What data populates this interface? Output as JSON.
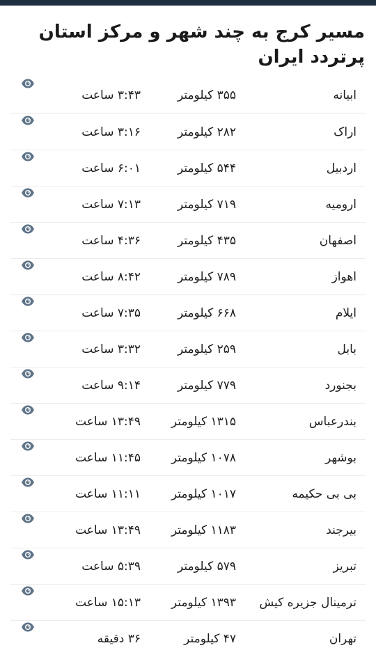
{
  "header": {
    "title": "مسیر کرج به چند شهر و مرکز استان پرتردد ایران"
  },
  "colors": {
    "top_bar": "#1f2d40",
    "eye_icon": "#5f7488",
    "divider": "#ececec"
  },
  "routes": [
    {
      "city": "ابیانه",
      "distance": "۳۵۵ کیلومتر",
      "time": "۳:۴۳ ساعت",
      "icon": "eye-icon"
    },
    {
      "city": "اراک",
      "distance": "۲۸۲ کیلومتر",
      "time": "۳:۱۶ ساعت",
      "icon": "eye-icon"
    },
    {
      "city": "اردبیل",
      "distance": "۵۴۴ کیلومتر",
      "time": "۶:۰۱ ساعت",
      "icon": "eye-icon"
    },
    {
      "city": "ارومیه",
      "distance": "۷۱۹ کیلومتر",
      "time": "۷:۱۳ ساعت",
      "icon": "eye-icon"
    },
    {
      "city": "اصفهان",
      "distance": "۴۳۵ کیلومتر",
      "time": "۴:۳۶ ساعت",
      "icon": "eye-icon"
    },
    {
      "city": "اهواز",
      "distance": "۷۸۹ کیلومتر",
      "time": "۸:۴۲ ساعت",
      "icon": "eye-icon"
    },
    {
      "city": "ایلام",
      "distance": "۶۶۸ کیلومتر",
      "time": "۷:۳۵ ساعت",
      "icon": "eye-icon"
    },
    {
      "city": "بابل",
      "distance": "۲۵۹ کیلومتر",
      "time": "۳:۳۲ ساعت",
      "icon": "eye-icon"
    },
    {
      "city": "بجنورد",
      "distance": "۷۷۹ کیلومتر",
      "time": "۹:۱۴ ساعت",
      "icon": "eye-icon"
    },
    {
      "city": "بندرعباس",
      "distance": "۱۳۱۵ کیلومتر",
      "time": "۱۳:۴۹ ساعت",
      "icon": "eye-icon"
    },
    {
      "city": "بوشهر",
      "distance": "۱۰۷۸ کیلومتر",
      "time": "۱۱:۴۵ ساعت",
      "icon": "eye-icon"
    },
    {
      "city": "بی بی حکیمه",
      "distance": "۱۰۱۷ کیلومتر",
      "time": "۱۱:۱۱ ساعت",
      "icon": "eye-icon"
    },
    {
      "city": "بیرجند",
      "distance": "۱۱۸۳ کیلومتر",
      "time": "۱۳:۴۹ ساعت",
      "icon": "eye-icon"
    },
    {
      "city": "تبریز",
      "distance": "۵۷۹ کیلومتر",
      "time": "۵:۳۹ ساعت",
      "icon": "eye-icon"
    },
    {
      "city": "ترمینال جزیره کیش",
      "distance": "۱۳۹۳ کیلومتر",
      "time": "۱۵:۱۳ ساعت",
      "icon": "eye-icon"
    },
    {
      "city": "تهران",
      "distance": "۴۷ کیلومتر",
      "time": "۳۶ دقیقه",
      "icon": "eye-icon"
    }
  ]
}
